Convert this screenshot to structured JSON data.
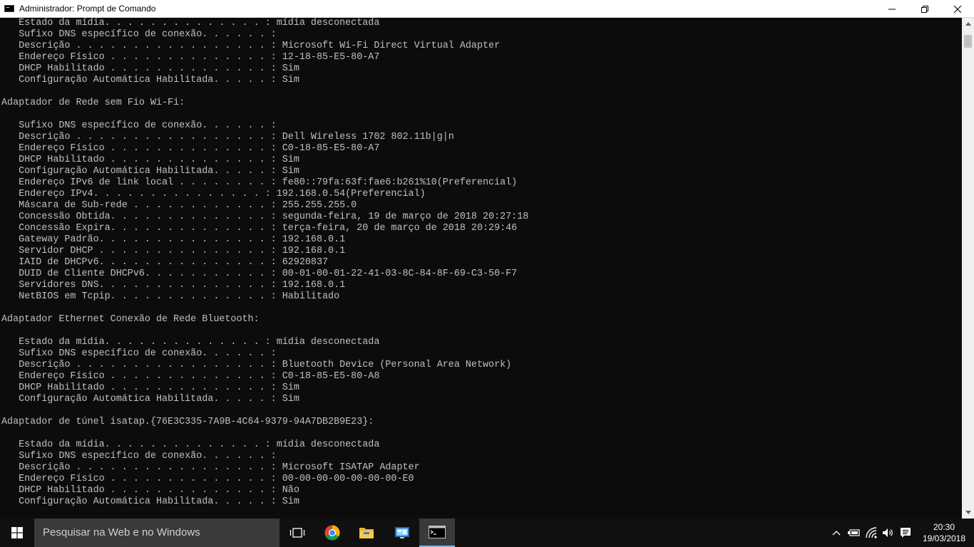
{
  "window": {
    "title": "Administrador: Prompt de Comando"
  },
  "console": {
    "lines": [
      "   Estado da mídia. . . . . . . . . . . . . . : mídia desconectada",
      "   Sufixo DNS específico de conexão. . . . . . :",
      "   Descrição . . . . . . . . . . . . . . . . . : Microsoft Wi-Fi Direct Virtual Adapter",
      "   Endereço Físico . . . . . . . . . . . . . . : 12-18-85-E5-80-A7",
      "   DHCP Habilitado . . . . . . . . . . . . . . : Sim",
      "   Configuração Automática Habilitada. . . . . : Sim",
      "",
      "Adaptador de Rede sem Fio Wi-Fi:",
      "",
      "   Sufixo DNS específico de conexão. . . . . . :",
      "   Descrição . . . . . . . . . . . . . . . . . : Dell Wireless 1702 802.11b|g|n",
      "   Endereço Físico . . . . . . . . . . . . . . : C0-18-85-E5-80-A7",
      "   DHCP Habilitado . . . . . . . . . . . . . . : Sim",
      "   Configuração Automática Habilitada. . . . . : Sim",
      "   Endereço IPv6 de link local . . . . . . . . : fe80::79fa:63f:fae6:b261%10(Preferencial)",
      "   Endereço IPv4. . . . . . . . . . . . . . . : 192.168.0.54(Preferencial)",
      "   Máscara de Sub-rede . . . . . . . . . . . . : 255.255.255.0",
      "   Concessão Obtida. . . . . . . . . . . . . . : segunda-feira, 19 de março de 2018 20:27:18",
      "   Concessão Expira. . . . . . . . . . . . . . : terça-feira, 20 de março de 2018 20:29:46",
      "   Gateway Padrão. . . . . . . . . . . . . . . : 192.168.0.1",
      "   Servidor DHCP . . . . . . . . . . . . . . . : 192.168.0.1",
      "   IAID de DHCPv6. . . . . . . . . . . . . . . : 62920837",
      "   DUID de Cliente DHCPv6. . . . . . . . . . . : 00-01-00-01-22-41-03-8C-84-8F-69-C3-50-F7",
      "   Servidores DNS. . . . . . . . . . . . . . . : 192.168.0.1",
      "   NetBIOS em Tcpip. . . . . . . . . . . . . . : Habilitado",
      "",
      "Adaptador Ethernet Conexão de Rede Bluetooth:",
      "",
      "   Estado da mídia. . . . . . . . . . . . . . : mídia desconectada",
      "   Sufixo DNS específico de conexão. . . . . . :",
      "   Descrição . . . . . . . . . . . . . . . . . : Bluetooth Device (Personal Area Network)",
      "   Endereço Físico . . . . . . . . . . . . . . : C0-18-85-E5-80-A8",
      "   DHCP Habilitado . . . . . . . . . . . . . . : Sim",
      "   Configuração Automática Habilitada. . . . . : Sim",
      "",
      "Adaptador de túnel isatap.{76E3C335-7A9B-4C64-9379-94A7DB2B9E23}:",
      "",
      "   Estado da mídia. . . . . . . . . . . . . . : mídia desconectada",
      "   Sufixo DNS específico de conexão. . . . . . :",
      "   Descrição . . . . . . . . . . . . . . . . . : Microsoft ISATAP Adapter",
      "   Endereço Físico . . . . . . . . . . . . . . : 00-00-00-00-00-00-00-E0",
      "   DHCP Habilitado . . . . . . . . . . . . . . : Não",
      "   Configuração Automática Habilitada. . . . . : Sim"
    ]
  },
  "taskbar": {
    "search_placeholder": "Pesquisar na Web e no Windows",
    "clock_time": "20:30",
    "clock_date": "19/03/2018"
  },
  "colors": {
    "console_bg": "#0c0c0c",
    "console_text": "#c0c0c0",
    "taskbar_bg": "#101010",
    "accent": "#76b9ed"
  }
}
